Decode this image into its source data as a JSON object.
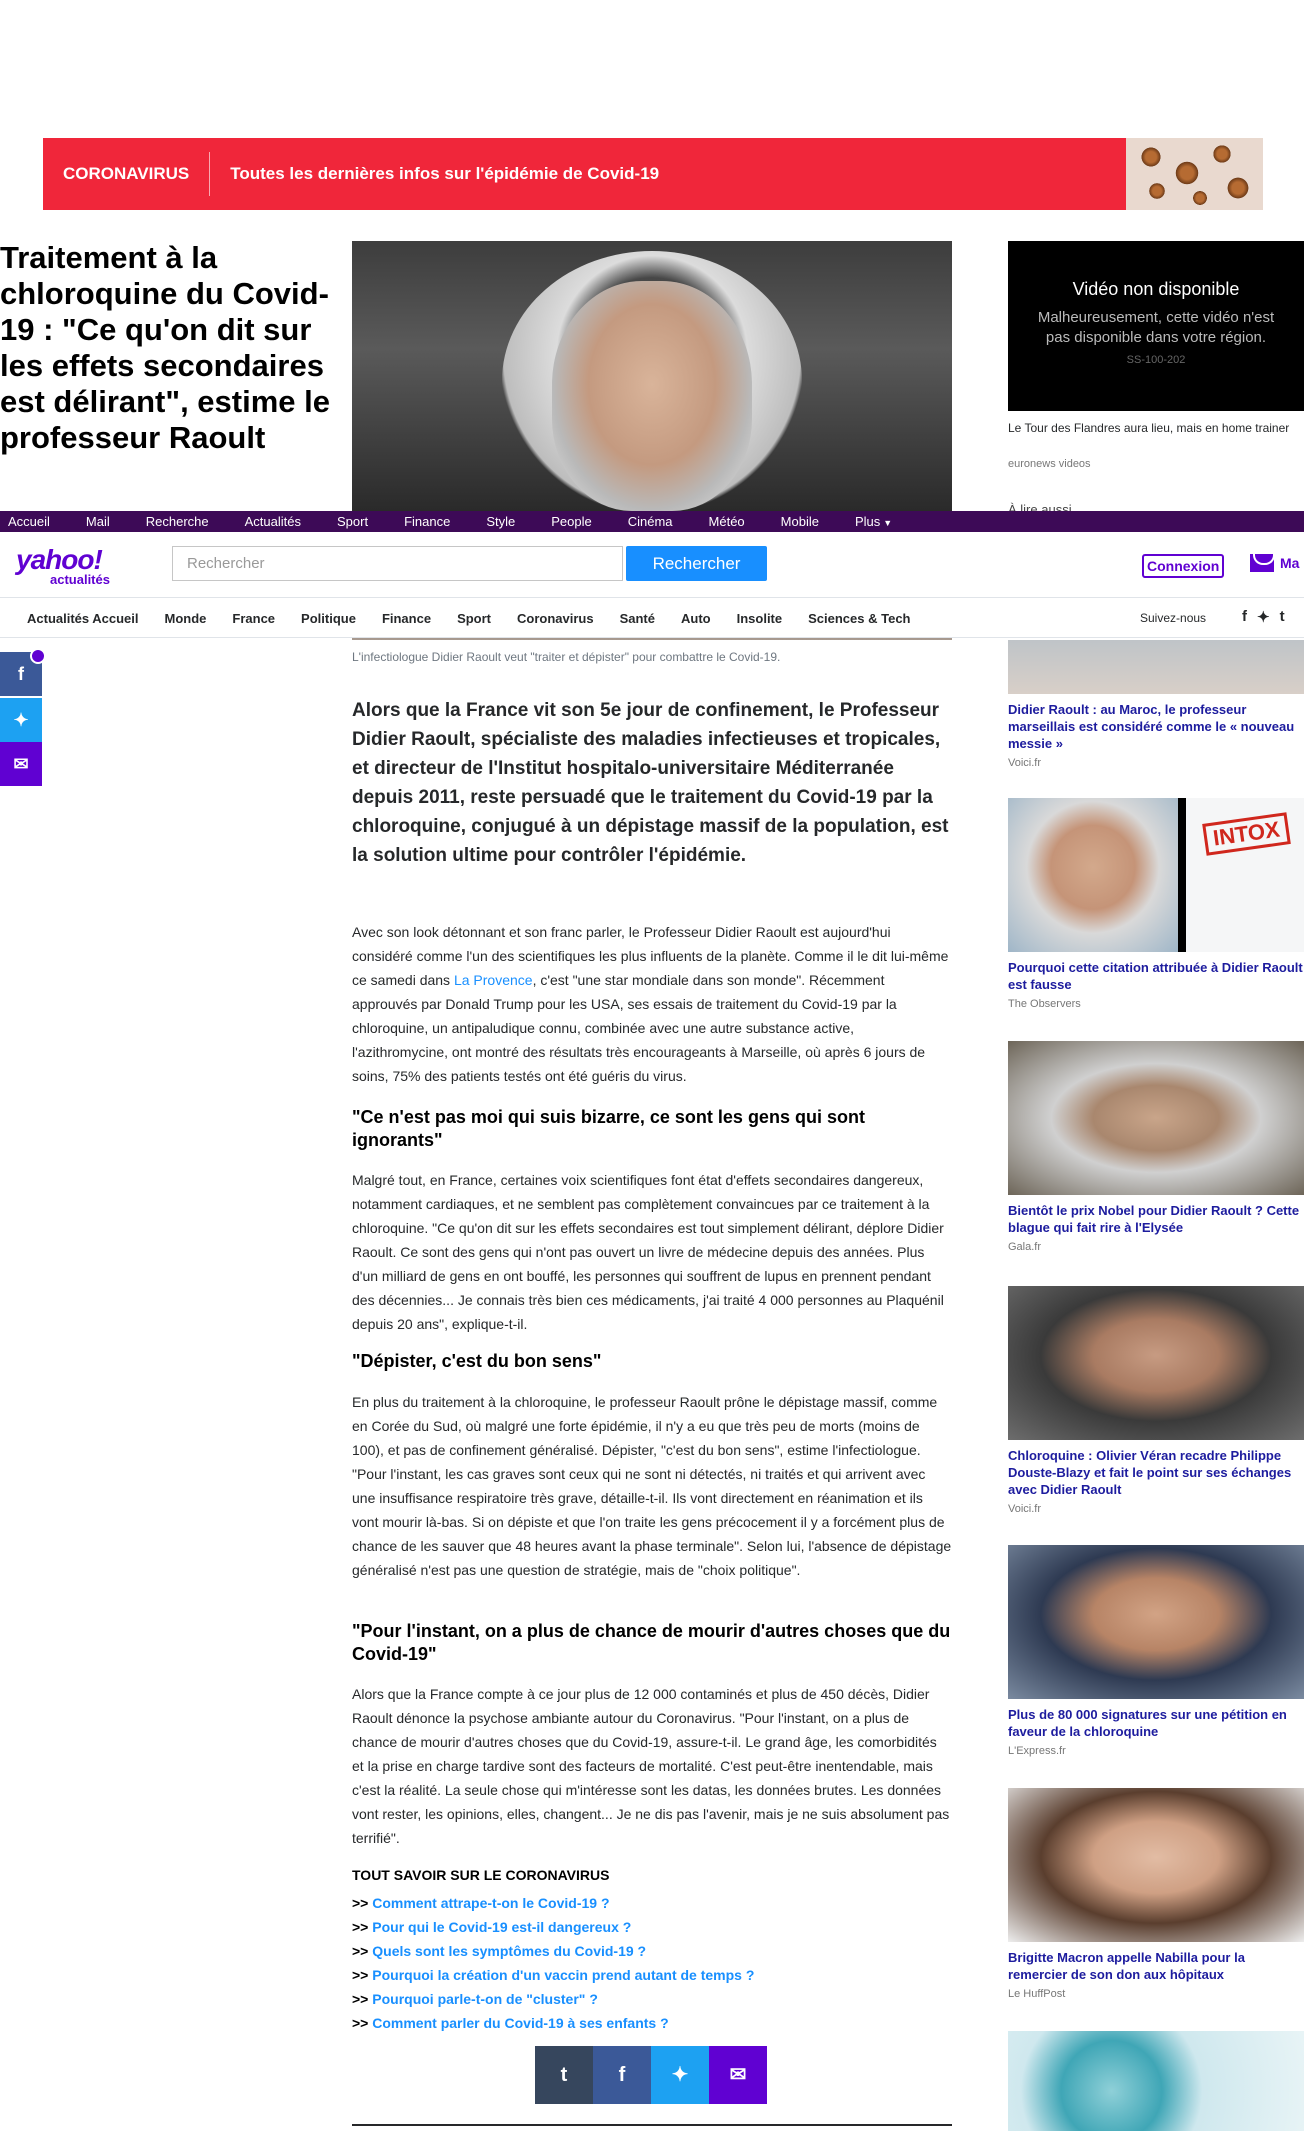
{
  "banner": {
    "tag": "CORONAVIRUS",
    "text": "Toutes les dernières infos sur l'épidémie de Covid-19"
  },
  "article": {
    "headline": "Traitement à la chloroquine du Covid-19 : \"Ce qu'on dit sur les effets secondaires est délirant\", estime le professeur Raoult",
    "caption": "L'infectiologue Didier Raoult veut \"traiter et dépister\" pour combattre le Covid-19.",
    "lede": "Alors que la France vit son 5e jour de confinement, le Professeur Didier Raoult, spécialiste des maladies infectieuses et tropicales, et directeur de l'Institut hospitalo-universitaire Méditerranée depuis 2011, reste persuadé que le traitement du Covid-19 par la chloroquine, conjugué à un dépistage massif de la population, est la solution ultime pour contrôler l'épidémie.",
    "p1_a": "Avec son look détonnant et son franc parler, le Professeur Didier Raoult est aujourd'hui considéré comme l'un des scientifiques les plus influents de la planète. Comme il le dit lui-même ce samedi dans ",
    "p1_link": "La Provence",
    "p1_b": ", c'est \"une star mondiale dans son monde\". Récemment approuvés par Donald Trump pour les USA, ses essais de traitement du Covid-19 par la chloroquine, un antipaludique connu, combinée avec une autre substance active, l'azithromycine, ont montré des résultats très encourageants à Marseille, où après 6 jours de soins, 75% des patients testés ont été guéris du virus.",
    "h1": "\"Ce n'est pas moi qui suis bizarre, ce sont les gens qui sont ignorants\"",
    "p2": "Malgré tout, en France, certaines voix scientifiques font état d'effets secondaires dangereux, notamment cardiaques, et ne semblent pas complètement convaincues par ce traitement à la chloroquine. \"Ce qu'on dit sur les effets secondaires est tout simplement délirant, déplore Didier Raoult. Ce sont des gens qui n'ont pas ouvert un livre de médecine depuis des années. Plus d'un milliard de gens en ont bouffé, les personnes qui souffrent de lupus en prennent pendant des décennies... Je connais très bien ces médicaments, j'ai traité 4 000 personnes au Plaquénil depuis 20 ans\", explique-t-il.",
    "h2": "\"Dépister, c'est du bon sens\"",
    "p3": "En plus du traitement à la chloroquine, le professeur Raoult prône le dépistage massif, comme en Corée du Sud, où malgré une forte épidémie, il n'y a eu que très peu de morts (moins de 100), et pas de confinement généralisé. Dépister, \"c'est du bon sens\", estime l'infectiologue. \"Pour l'instant, les cas graves sont ceux qui ne sont ni détectés, ni traités et qui arrivent avec une insuffisance respiratoire très grave, détaille-t-il. Ils vont directement en réanimation et ils vont mourir là-bas. Si on dépiste et que l'on traite les gens précocement il y a forcément plus de chance de les sauver que 48 heures avant la phase terminale\". Selon lui, l'absence de dépistage généralisé n'est pas une question de stratégie, mais de \"choix politique\".",
    "h3": "\"Pour l'instant, on a plus de chance de mourir d'autres choses que du Covid-19\"",
    "p4": "Alors que la France compte à ce jour plus de 12 000 contaminés et plus de 450 décès, Didier Raoult dénonce la psychose ambiante autour du Coronavirus. \"Pour l'instant, on a plus de chance de mourir d'autres choses que du Covid-19, assure-t-il. Le grand âge, les comorbidités et la prise en charge tardive sont des facteurs de mortalité. C'est peut-être inentendable, mais c'est la réalité. La seule chose qui m'intéresse sont les datas, les données brutes. Les données vont rester, les opinions, elles, changent... Je ne dis pas l'avenir, mais je ne suis absolument pas terrifié\".",
    "tout_title": "TOUT SAVOIR SUR LE CORONAVIRUS",
    "tout_links": [
      "Comment attrape-t-on le Covid-19 ?",
      "Pour qui le Covid-19 est-il dangereux ?",
      "Quels sont les symptômes du Covid-19 ?",
      "Pourquoi la création d'un vaccin prend autant de temps ?",
      "Pourquoi parle-t-on de \"cluster\" ?",
      "Comment parler du Covid-19 à ses enfants ?"
    ],
    "tout_prefix": ">>"
  },
  "video": {
    "title": "Vidéo non disponible",
    "message": "Malheureusement, cette vidéo n'est pas disponible dans votre région.",
    "code": "SS-100-202",
    "caption": "Le Tour des Flandres aura lieu, mais en home trainer",
    "source": "euronews videos",
    "a_lire": "À lire aussi"
  },
  "topnav": [
    "Accueil",
    "Mail",
    "Recherche",
    "Actualités",
    "Sport",
    "Finance",
    "Style",
    "People",
    "Cinéma",
    "Météo",
    "Mobile",
    "Plus"
  ],
  "header": {
    "logo": "yahoo!",
    "logo_sub": "actualités",
    "search_placeholder": "Rechercher",
    "search_button": "Rechercher",
    "login": "Connexion",
    "mail": "Ma"
  },
  "catnav": [
    "Actualités Accueil",
    "Monde",
    "France",
    "Politique",
    "Finance",
    "Sport",
    "Coronavirus",
    "Santé",
    "Auto",
    "Insolite",
    "Sciences & Tech"
  ],
  "follow": "Suivez-nous",
  "rail": [
    {
      "title": "Didier Raoult : au Maroc, le professeur marseillais est considéré comme le « nouveau messie »",
      "source": "Voici.fr"
    },
    {
      "title": "Pourquoi cette citation attribuée à Didier Raoult est fausse",
      "source": "The Observers",
      "stamp": "INTOX"
    },
    {
      "title": "Bientôt le prix Nobel pour Didier Raoult ? Cette blague qui fait rire à l'Elysée",
      "source": "Gala.fr"
    },
    {
      "title": "Chloroquine : Olivier Véran recadre Philippe Douste-Blazy et fait le point sur ses échanges avec Didier Raoult",
      "source": "Voici.fr"
    },
    {
      "title": "Plus de 80 000 signatures sur une pétition en faveur de la chloroquine",
      "source": "L'Express.fr"
    },
    {
      "title": "Brigitte Macron appelle Nabilla pour la remercier de son don aux hôpitaux",
      "source": "Le HuffPost"
    }
  ],
  "colors": {
    "banner": "#f0263a",
    "yahoo_purple": "#6001d2",
    "nav_purple": "#3d0a57",
    "link_blue": "#188fff",
    "rail_title": "#1d1c9e"
  },
  "icons": {
    "tumblr": "t",
    "facebook": "f",
    "twitter": "twitter-bird",
    "mail": "envelope"
  }
}
